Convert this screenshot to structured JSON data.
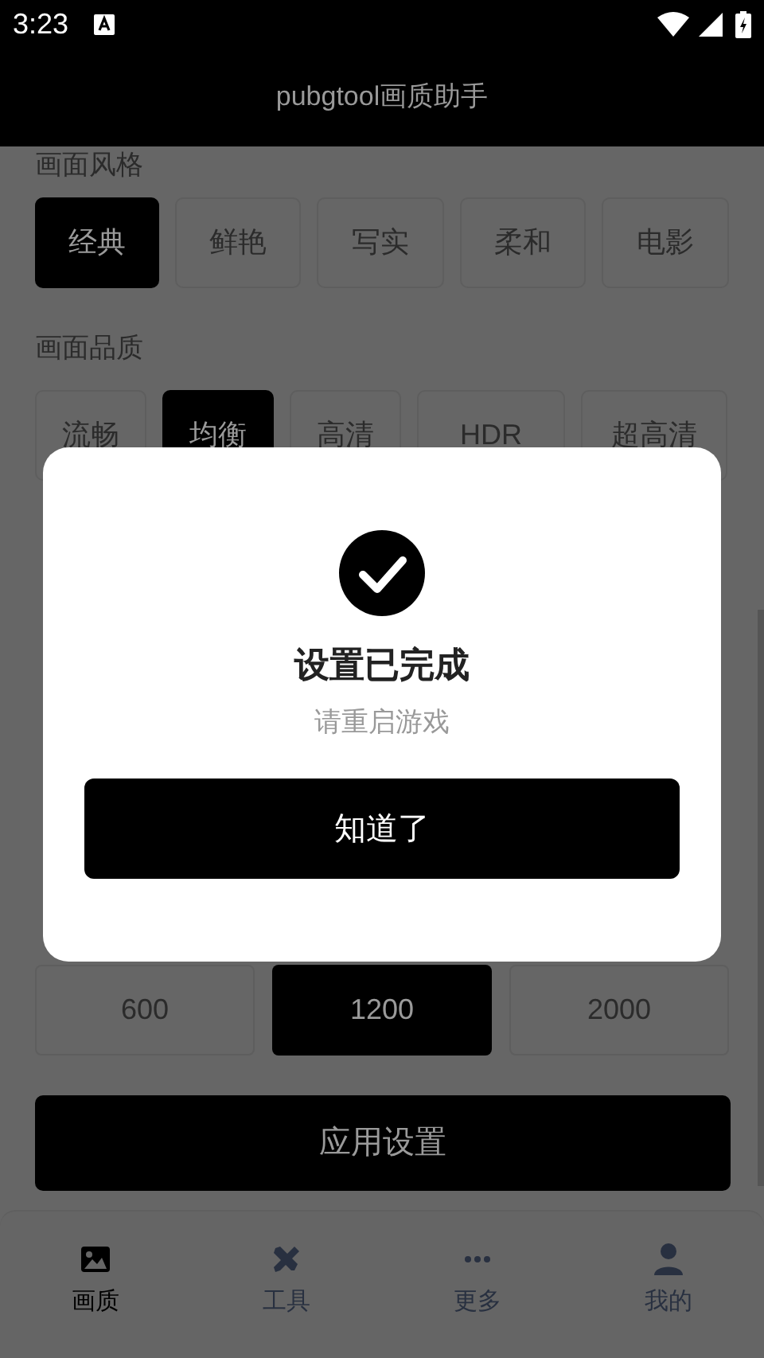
{
  "status_bar": {
    "time": "3:23"
  },
  "app_bar": {
    "title": "pubgtool画质助手"
  },
  "sections": [
    {
      "label": "画面风格",
      "options": [
        {
          "label": "经典",
          "selected": true
        },
        {
          "label": "鲜艳",
          "selected": false
        },
        {
          "label": "写实",
          "selected": false
        },
        {
          "label": "柔和",
          "selected": false
        },
        {
          "label": "电影",
          "selected": false
        }
      ]
    },
    {
      "label": "画面品质",
      "options": [
        {
          "label": "流畅",
          "selected": false
        },
        {
          "label": "均衡",
          "selected": true
        },
        {
          "label": "高清",
          "selected": false
        },
        {
          "label": "HDR",
          "selected": false
        },
        {
          "label": "超高清",
          "selected": false
        }
      ]
    }
  ],
  "bitrate_options": [
    {
      "label": "600",
      "selected": false
    },
    {
      "label": "1200",
      "selected": true
    },
    {
      "label": "2000",
      "selected": false
    }
  ],
  "apply_button": "应用设置",
  "bottom_nav": [
    {
      "label": "画质",
      "selected": true
    },
    {
      "label": "工具",
      "selected": false
    },
    {
      "label": "更多",
      "selected": false
    },
    {
      "label": "我的",
      "selected": false
    }
  ],
  "dialog": {
    "title": "设置已完成",
    "message": "请重启游戏",
    "button": "知道了"
  }
}
